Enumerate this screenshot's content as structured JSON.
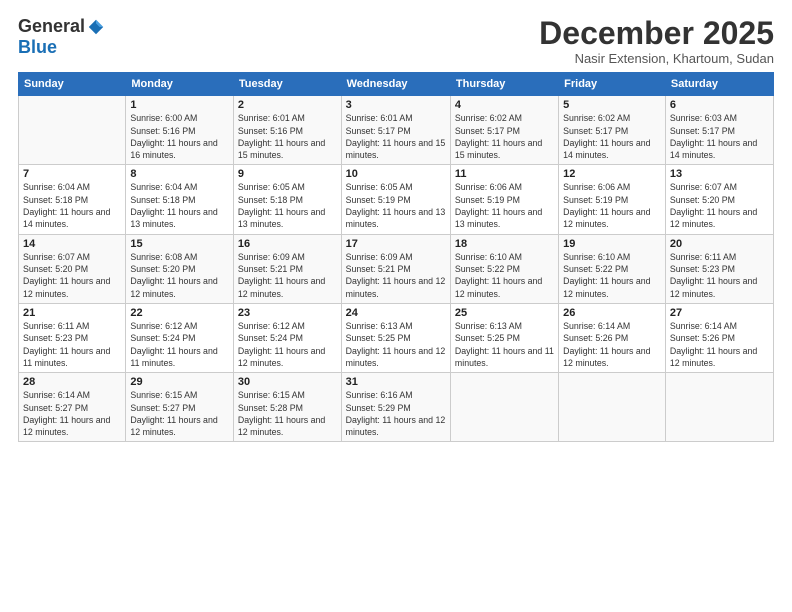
{
  "header": {
    "logo_general": "General",
    "logo_blue": "Blue",
    "month_title": "December 2025",
    "subtitle": "Nasir Extension, Khartoum, Sudan"
  },
  "days_of_week": [
    "Sunday",
    "Monday",
    "Tuesday",
    "Wednesday",
    "Thursday",
    "Friday",
    "Saturday"
  ],
  "weeks": [
    [
      {
        "day": "",
        "sunrise": "",
        "sunset": "",
        "daylight": ""
      },
      {
        "day": "1",
        "sunrise": "Sunrise: 6:00 AM",
        "sunset": "Sunset: 5:16 PM",
        "daylight": "Daylight: 11 hours and 16 minutes."
      },
      {
        "day": "2",
        "sunrise": "Sunrise: 6:01 AM",
        "sunset": "Sunset: 5:16 PM",
        "daylight": "Daylight: 11 hours and 15 minutes."
      },
      {
        "day": "3",
        "sunrise": "Sunrise: 6:01 AM",
        "sunset": "Sunset: 5:17 PM",
        "daylight": "Daylight: 11 hours and 15 minutes."
      },
      {
        "day": "4",
        "sunrise": "Sunrise: 6:02 AM",
        "sunset": "Sunset: 5:17 PM",
        "daylight": "Daylight: 11 hours and 15 minutes."
      },
      {
        "day": "5",
        "sunrise": "Sunrise: 6:02 AM",
        "sunset": "Sunset: 5:17 PM",
        "daylight": "Daylight: 11 hours and 14 minutes."
      },
      {
        "day": "6",
        "sunrise": "Sunrise: 6:03 AM",
        "sunset": "Sunset: 5:17 PM",
        "daylight": "Daylight: 11 hours and 14 minutes."
      }
    ],
    [
      {
        "day": "7",
        "sunrise": "Sunrise: 6:04 AM",
        "sunset": "Sunset: 5:18 PM",
        "daylight": "Daylight: 11 hours and 14 minutes."
      },
      {
        "day": "8",
        "sunrise": "Sunrise: 6:04 AM",
        "sunset": "Sunset: 5:18 PM",
        "daylight": "Daylight: 11 hours and 13 minutes."
      },
      {
        "day": "9",
        "sunrise": "Sunrise: 6:05 AM",
        "sunset": "Sunset: 5:18 PM",
        "daylight": "Daylight: 11 hours and 13 minutes."
      },
      {
        "day": "10",
        "sunrise": "Sunrise: 6:05 AM",
        "sunset": "Sunset: 5:19 PM",
        "daylight": "Daylight: 11 hours and 13 minutes."
      },
      {
        "day": "11",
        "sunrise": "Sunrise: 6:06 AM",
        "sunset": "Sunset: 5:19 PM",
        "daylight": "Daylight: 11 hours and 13 minutes."
      },
      {
        "day": "12",
        "sunrise": "Sunrise: 6:06 AM",
        "sunset": "Sunset: 5:19 PM",
        "daylight": "Daylight: 11 hours and 12 minutes."
      },
      {
        "day": "13",
        "sunrise": "Sunrise: 6:07 AM",
        "sunset": "Sunset: 5:20 PM",
        "daylight": "Daylight: 11 hours and 12 minutes."
      }
    ],
    [
      {
        "day": "14",
        "sunrise": "Sunrise: 6:07 AM",
        "sunset": "Sunset: 5:20 PM",
        "daylight": "Daylight: 11 hours and 12 minutes."
      },
      {
        "day": "15",
        "sunrise": "Sunrise: 6:08 AM",
        "sunset": "Sunset: 5:20 PM",
        "daylight": "Daylight: 11 hours and 12 minutes."
      },
      {
        "day": "16",
        "sunrise": "Sunrise: 6:09 AM",
        "sunset": "Sunset: 5:21 PM",
        "daylight": "Daylight: 11 hours and 12 minutes."
      },
      {
        "day": "17",
        "sunrise": "Sunrise: 6:09 AM",
        "sunset": "Sunset: 5:21 PM",
        "daylight": "Daylight: 11 hours and 12 minutes."
      },
      {
        "day": "18",
        "sunrise": "Sunrise: 6:10 AM",
        "sunset": "Sunset: 5:22 PM",
        "daylight": "Daylight: 11 hours and 12 minutes."
      },
      {
        "day": "19",
        "sunrise": "Sunrise: 6:10 AM",
        "sunset": "Sunset: 5:22 PM",
        "daylight": "Daylight: 11 hours and 12 minutes."
      },
      {
        "day": "20",
        "sunrise": "Sunrise: 6:11 AM",
        "sunset": "Sunset: 5:23 PM",
        "daylight": "Daylight: 11 hours and 12 minutes."
      }
    ],
    [
      {
        "day": "21",
        "sunrise": "Sunrise: 6:11 AM",
        "sunset": "Sunset: 5:23 PM",
        "daylight": "Daylight: 11 hours and 11 minutes."
      },
      {
        "day": "22",
        "sunrise": "Sunrise: 6:12 AM",
        "sunset": "Sunset: 5:24 PM",
        "daylight": "Daylight: 11 hours and 11 minutes."
      },
      {
        "day": "23",
        "sunrise": "Sunrise: 6:12 AM",
        "sunset": "Sunset: 5:24 PM",
        "daylight": "Daylight: 11 hours and 12 minutes."
      },
      {
        "day": "24",
        "sunrise": "Sunrise: 6:13 AM",
        "sunset": "Sunset: 5:25 PM",
        "daylight": "Daylight: 11 hours and 12 minutes."
      },
      {
        "day": "25",
        "sunrise": "Sunrise: 6:13 AM",
        "sunset": "Sunset: 5:25 PM",
        "daylight": "Daylight: 11 hours and 11 minutes."
      },
      {
        "day": "26",
        "sunrise": "Sunrise: 6:14 AM",
        "sunset": "Sunset: 5:26 PM",
        "daylight": "Daylight: 11 hours and 12 minutes."
      },
      {
        "day": "27",
        "sunrise": "Sunrise: 6:14 AM",
        "sunset": "Sunset: 5:26 PM",
        "daylight": "Daylight: 11 hours and 12 minutes."
      }
    ],
    [
      {
        "day": "28",
        "sunrise": "Sunrise: 6:14 AM",
        "sunset": "Sunset: 5:27 PM",
        "daylight": "Daylight: 11 hours and 12 minutes."
      },
      {
        "day": "29",
        "sunrise": "Sunrise: 6:15 AM",
        "sunset": "Sunset: 5:27 PM",
        "daylight": "Daylight: 11 hours and 12 minutes."
      },
      {
        "day": "30",
        "sunrise": "Sunrise: 6:15 AM",
        "sunset": "Sunset: 5:28 PM",
        "daylight": "Daylight: 11 hours and 12 minutes."
      },
      {
        "day": "31",
        "sunrise": "Sunrise: 6:16 AM",
        "sunset": "Sunset: 5:29 PM",
        "daylight": "Daylight: 11 hours and 12 minutes."
      },
      {
        "day": "",
        "sunrise": "",
        "sunset": "",
        "daylight": ""
      },
      {
        "day": "",
        "sunrise": "",
        "sunset": "",
        "daylight": ""
      },
      {
        "day": "",
        "sunrise": "",
        "sunset": "",
        "daylight": ""
      }
    ]
  ]
}
